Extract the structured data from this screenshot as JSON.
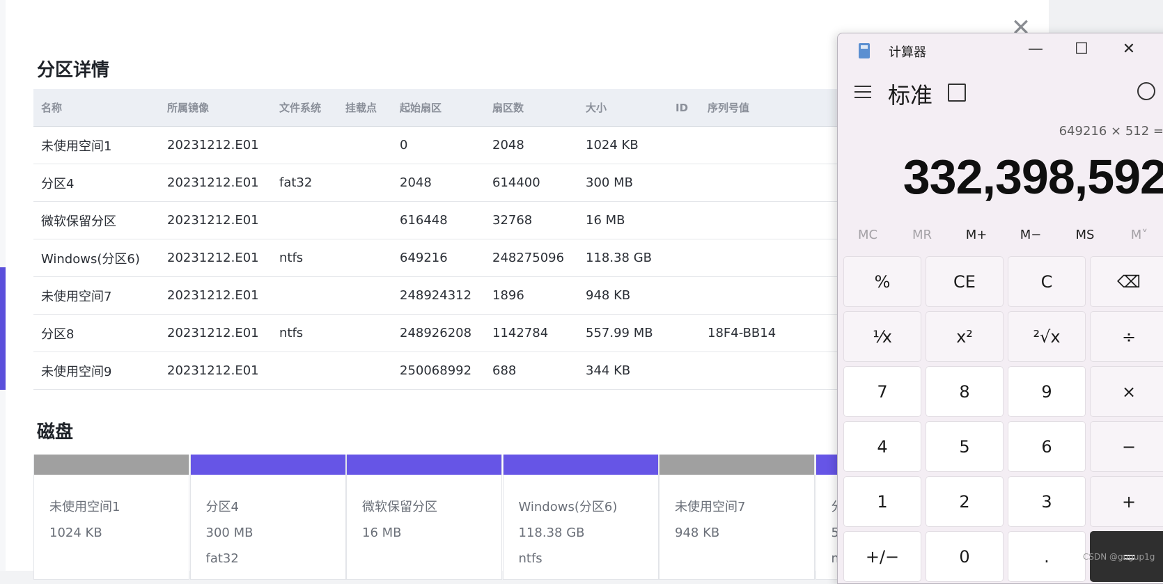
{
  "partitions": {
    "title": "分区详情",
    "columns": [
      "名称",
      "所属镜像",
      "文件系统",
      "挂载点",
      "起始扇区",
      "扇区数",
      "大小",
      "ID",
      "序列号值"
    ],
    "rows": [
      [
        "未使用空间1",
        "20231212.E01",
        "",
        "",
        "0",
        "2048",
        "1024 KB",
        "",
        ""
      ],
      [
        "分区4",
        "20231212.E01",
        "fat32",
        "",
        "2048",
        "614400",
        "300 MB",
        "",
        ""
      ],
      [
        "微软保留分区",
        "20231212.E01",
        "",
        "",
        "616448",
        "32768",
        "16 MB",
        "",
        ""
      ],
      [
        "Windows(分区6)",
        "20231212.E01",
        "ntfs",
        "",
        "649216",
        "248275096",
        "118.38 GB",
        "",
        ""
      ],
      [
        "未使用空间7",
        "20231212.E01",
        "",
        "",
        "248924312",
        "1896",
        "948 KB",
        "",
        ""
      ],
      [
        "分区8",
        "20231212.E01",
        "ntfs",
        "",
        "248926208",
        "1142784",
        "557.99 MB",
        "",
        "18F4-BB14"
      ],
      [
        "未使用空间9",
        "20231212.E01",
        "",
        "",
        "250068992",
        "688",
        "344 KB",
        "",
        ""
      ]
    ]
  },
  "disk": {
    "title": "磁盘",
    "colors": {
      "unused": "#a0a0a0",
      "partition": "#6655e6"
    },
    "cells": [
      {
        "kind": "unused",
        "name": "未使用空间1",
        "size": "1024 KB",
        "fs": ""
      },
      {
        "kind": "partition",
        "name": "分区4",
        "size": "300 MB",
        "fs": "fat32"
      },
      {
        "kind": "partition",
        "name": "微软保留分区",
        "size": "16 MB",
        "fs": ""
      },
      {
        "kind": "partition",
        "name": "Windows(分区6)",
        "size": "118.38 GB",
        "fs": "ntfs"
      },
      {
        "kind": "unused",
        "name": "未使用空间7",
        "size": "948 KB",
        "fs": ""
      },
      {
        "kind": "partition",
        "name": "分",
        "size": "5",
        "fs": "n"
      }
    ]
  },
  "calculator": {
    "title": "计算器",
    "mode": "标准",
    "expression": "649216 × 512 =",
    "result": "332,398,592",
    "memory": [
      "MC",
      "MR",
      "M+",
      "M−",
      "MS",
      "M˅"
    ],
    "memory_enabled": [
      false,
      false,
      true,
      true,
      true,
      false
    ],
    "keys": [
      [
        "%",
        "CE",
        "C",
        "⌫"
      ],
      [
        "⅟x",
        "x²",
        "²√x",
        "÷"
      ],
      [
        "7",
        "8",
        "9",
        "×"
      ],
      [
        "4",
        "5",
        "6",
        "−"
      ],
      [
        "1",
        "2",
        "3",
        "+"
      ],
      [
        "+/−",
        "0",
        ".",
        "="
      ]
    ],
    "key_names": [
      [
        "percent",
        "clear-entry",
        "clear",
        "backspace"
      ],
      [
        "reciprocal",
        "square",
        "square-root",
        "divide"
      ],
      [
        "7",
        "8",
        "9",
        "multiply"
      ],
      [
        "4",
        "5",
        "6",
        "minus"
      ],
      [
        "1",
        "2",
        "3",
        "plus"
      ],
      [
        "negate",
        "0",
        "decimal",
        "equals"
      ]
    ],
    "window_buttons": {
      "minimize": "—",
      "maximize": "☐",
      "close": "✕"
    }
  },
  "modal": {
    "close_glyph": "✕"
  },
  "watermark": "CSDN @gugup1g"
}
